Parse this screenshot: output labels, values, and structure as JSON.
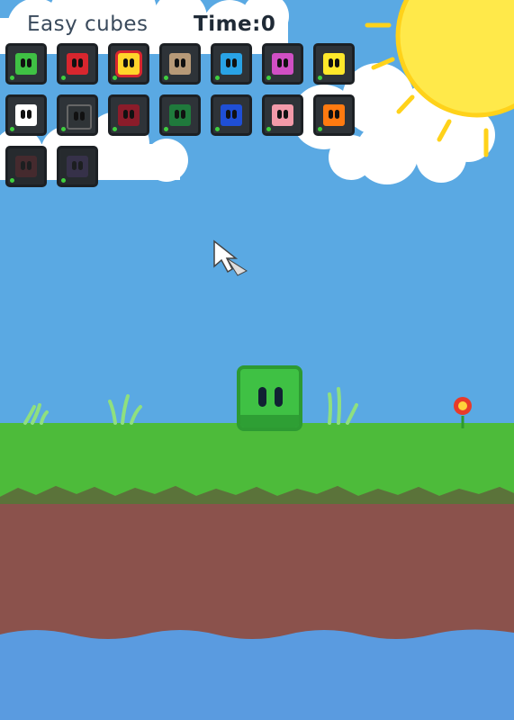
{
  "hud": {
    "title": "Easy cubes",
    "time": "Time:0"
  },
  "colors": {
    "sky": "#5aa9e3",
    "grass": "#4dbb3a",
    "dirt": "#8b524c",
    "water": "#5a9be0",
    "sun": "#ffe94a"
  },
  "skins": [
    {
      "name": "green",
      "color": "#3fc144"
    },
    {
      "name": "red",
      "color": "#d8262e"
    },
    {
      "name": "yellow-frilled",
      "color": "#ffd42a"
    },
    {
      "name": "tan",
      "color": "#b79a78"
    },
    {
      "name": "blue",
      "color": "#29a3e6"
    },
    {
      "name": "magenta",
      "color": "#d04fc4"
    },
    {
      "name": "yellow",
      "color": "#ffe82a"
    },
    {
      "name": "white",
      "color": "#ffffff"
    },
    {
      "name": "black",
      "color": "#2f3437"
    },
    {
      "name": "maroon",
      "color": "#8b1c2a"
    },
    {
      "name": "dark-green",
      "color": "#1f7a3c"
    },
    {
      "name": "navy",
      "color": "#1f4fd6"
    },
    {
      "name": "pink-bow",
      "color": "#f29aa9"
    },
    {
      "name": "orange",
      "color": "#ff7a10"
    },
    {
      "name": "brown-locked",
      "color": "#6b2a2e"
    },
    {
      "name": "purple-locked",
      "color": "#4a3a6a"
    }
  ],
  "icons": [
    "mouse-cursor-icon",
    "sun-icon",
    "flower-icon",
    "cloud-icon"
  ]
}
